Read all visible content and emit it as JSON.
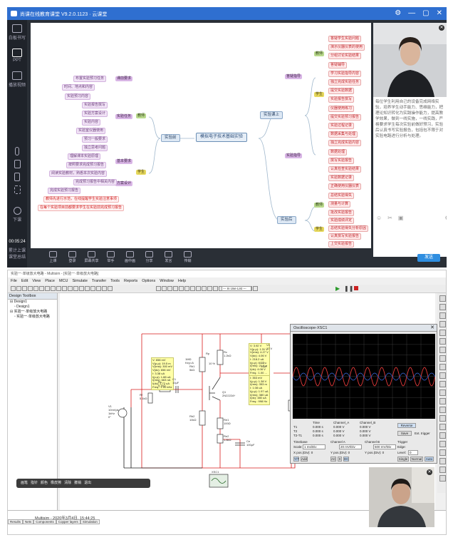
{
  "top": {
    "title": "尚课在线教育课堂 V9.2.0.1123 · 云课堂",
    "win_controls": [
      "⚙",
      "—",
      "▢",
      "✕"
    ],
    "sidebar": [
      {
        "label": "白板书写",
        "icon": "whiteboard-icon"
      },
      {
        "label": "PPT",
        "icon": "ppt-icon"
      },
      {
        "label": "播放视频",
        "icon": "video-icon"
      },
      {
        "label": "",
        "icon": "mic-icon"
      },
      {
        "label": "",
        "icon": "speaker-icon"
      },
      {
        "label": "",
        "icon": "music-icon"
      },
      {
        "label": "",
        "icon": "expand-icon"
      },
      {
        "label": "下课",
        "icon": "power-icon"
      }
    ],
    "timer": "00:05:24",
    "timer_label": "累计上课",
    "extra_label": "课堂总结",
    "toolbar": [
      "上课",
      "登录",
      "屏幕共享",
      "举手",
      "画中画",
      "分享",
      "发言",
      "传输"
    ],
    "chat_text": "每位学生利用自己的设备完成网络实验，培养学生动手能力、思维能力，把理论知识转化为实践操作能力，提高教学效果，做到一线实施，一线实践，严格要求学生每次实验前做好预习，实验后认真书写实验报告，包括包不限于对实验电路进行分析与处理。",
    "send_label": "发送",
    "chat_tools": [
      "☺",
      "✂",
      "▣",
      "⚙"
    ],
    "mindmap": {
      "root": "模拟电子技术基础实验",
      "branch_before": "实验前",
      "branch_during": "实验课上",
      "branch_after": "实验后",
      "before_teacher": "教师",
      "before_student": "学生",
      "during_teacher": "教师",
      "during_student": "学生",
      "after_teacher": "教师",
      "after_student": "学生",
      "before_left_groups": [
        "课前要求",
        "实验任务",
        "基本要求",
        "方案设计"
      ],
      "before_left_leaves": [
        "布置实验预习任务",
        "时间、地点和内容",
        "实验预习内容",
        "实验报告撰写",
        "实验方案设计",
        "实验内容",
        "实验室仪器使用",
        "预习一般要求",
        "独立思考问题",
        "理解课本实验原理",
        "按照要求完成预习报告",
        "阅读实验教材，熟悉本次实验内容",
        "完成预习报告中相关内容",
        "完成实验预习报告",
        "实验前预习报告审查"
      ],
      "before_red": [
        "教师先进行示范，在线提醒学生实验注意事项",
        "在每个实验项目前都要求学生在实验前完成预习报告"
      ],
      "during_groups": [
        "答疑指导",
        "实验指导",
        "实验操作"
      ],
      "during_leaves": [
        "答疑学生实验问题",
        "演示仪器仪表的使用",
        "分组讨论实验结果",
        "答疑辅导",
        "学习实验指导内容",
        "独立完成实验任务",
        "提交实验数据",
        "实验报告撰写",
        "仪器使用练习",
        "提交实验预习报告",
        "实验过程记录",
        "数据采集与处理",
        "独立完成实验内容",
        "数据处理",
        "撰写实验报告",
        "认真检查实验结果",
        "实验数据记录",
        "正确使用仪器仪表",
        "总结实验得失",
        "测量与计算"
      ],
      "after_leaves": [
        "批改实验报告",
        "实验成绩评定",
        "总结实验得失分析原因",
        "认真撰写实验报告",
        "上交实验报告"
      ]
    }
  },
  "bottom": {
    "title": "实验一·单级放大电路 - Multisim - [实验一·单级放大电路]",
    "menu": [
      "File",
      "Edit",
      "View",
      "Place",
      "MCU",
      "Simulate",
      "Transfer",
      "Tools",
      "Reports",
      "Options",
      "Window",
      "Help"
    ],
    "in_use_list": "--- In Use List ---",
    "toolbox_title": "Design Toolbox",
    "tree": [
      "Design1",
      "Design1",
      "实验一·单级放大电路",
      "实验一·单级放大电路"
    ],
    "status_line": "Multisim - 2020年3月4日, 15:44:25",
    "tabs": [
      "Results",
      "Nets",
      "Components",
      "Copper layers",
      "Simulation"
    ],
    "share_bar": [
      "画笔",
      "指针",
      "颜色",
      "橡皮擦",
      "清除",
      "撤销",
      "退出"
    ],
    "oscilloscope": {
      "title": "Oscilloscope-XSC1",
      "cols": [
        "Time",
        "Channel_A",
        "Channel_B"
      ],
      "t1": [
        "0.000 s",
        "0.000 V",
        "0.000 V"
      ],
      "t2": [
        "0.000 s",
        "0.000 V",
        "0.000 V"
      ],
      "t2t1": [
        "0.000 s",
        "0.000 V",
        "0.000 V"
      ],
      "reverse": "Reverse",
      "save": "Save",
      "ext_trigger": "Ext. trigger",
      "timebase_scale": "1 ms/Div",
      "cha_scale": "20 mV/Div",
      "chb_scale": "500 mV/Div",
      "trigger_level": "0"
    },
    "probe_left": "V: 658 mV\nV(p-p): 19.5 m\nV(rms): 300 mV\nV(dc): 658 mV\nI: 3.38 uA\nI(p-p): 1.88 uA\nI(rms): 663 nA\nI(dc): 1.72 uA\nFreq.: 1.00 kHz",
    "probe_right": "V: 3.92 V\nV(p-p): 1.31 V\nV(rms): 4.27 V\nV(dc): 4.06 V\nI: 218.2 uA\nI(p-p): 61.0 u\nI(rms): 21.5 u\nI(dc): 4.08 V\nFreq.: 1.00 ...",
    "probe_right2": "I: 353 mV\nI(p-p): 1.38 V\nI(rms): 353 m\nI: 1.08 uA\nI(p-p): 1.97 uA\nI(rms): 380 uA\nI(dc): 380 uA\nFreq.: 998 Hz",
    "labels": {
      "rp": "Rp",
      "rp_val": "1MΩ\nKey=A",
      "rp_pct": "10 %",
      "rb1": "Rb1\n5kΩ",
      "rb2": "Rb2\n10kΩ",
      "re1": "Re1\n100Ω",
      "re2": "Re2\n1.8kΩ",
      "rc": "Rc\n1.2kΩ",
      "rl": "RL\n5kΩ",
      "rs": "Rs\n5.1kΩ",
      "rf": "Rf\n5.1kΩ",
      "c1": "C1\n10μF",
      "c2": "C2\n10μF",
      "ce": "Ce\n100μF",
      "v1": "V1\n12 V",
      "vs": "V1\n10mVpk\n1kHz\n0°",
      "q1": "Q1\n2N2222A*",
      "xsc": "XSC1"
    }
  }
}
